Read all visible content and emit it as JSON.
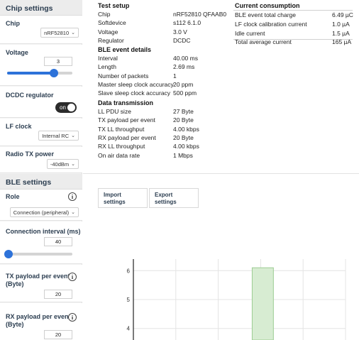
{
  "sidebar": {
    "chip_settings": {
      "title": "Chip settings",
      "chip_label": "Chip",
      "chip_value": "nRF52810",
      "voltage_label": "Voltage",
      "voltage_value": "3",
      "voltage_level": 0.72,
      "dcdc_label": "DCDC regulator",
      "dcdc_state": "on",
      "lf_clock_label": "LF clock",
      "lf_clock_value": "Internal RC",
      "radio_tx_label": "Radio TX power",
      "radio_tx_value": "-40dBm"
    },
    "ble_settings": {
      "title": "BLE settings",
      "role_label": "Role",
      "role_value": "Connection (peripheral)",
      "conn_interval_label": "Connection interval (ms)",
      "conn_interval_value": "40",
      "conn_interval_level": 0.02,
      "tx_payload_label_1": "TX payload per event",
      "tx_payload_label_2": "(Byte)",
      "tx_payload_value": "20",
      "rx_payload_label_1": "RX payload per event",
      "rx_payload_label_2": "(Byte)",
      "rx_payload_value": "20"
    }
  },
  "test_setup": {
    "title": "Test setup",
    "rows": [
      {
        "label": "Chip",
        "value": "nRF52810 QFAAB0"
      },
      {
        "label": "Softdevice",
        "value": "s112 6.1.0"
      },
      {
        "label": "Voltage",
        "value": "3.0 V"
      },
      {
        "label": "Regulator",
        "value": "DCDC"
      }
    ]
  },
  "ble_event_details": {
    "title": "BLE event details",
    "rows": [
      {
        "label": "Interval",
        "value": "40.00 ms"
      },
      {
        "label": "Length",
        "value": "2.69 ms"
      },
      {
        "label": "Number of packets",
        "value": "1"
      },
      {
        "label": "Master sleep clock accuracy",
        "value": "20 ppm"
      },
      {
        "label": "Slave sleep clock accuracy",
        "value": "500 ppm"
      }
    ]
  },
  "data_transmission": {
    "title": "Data transmission",
    "rows": [
      {
        "label": "LL PDU size",
        "value": "27 Byte"
      },
      {
        "label": "TX payload per event",
        "value": "20 Byte"
      },
      {
        "label": "TX LL throughput",
        "value": "4.00 kbps"
      },
      {
        "label": "RX payload per event",
        "value": "20 Byte"
      },
      {
        "label": "RX LL throughput",
        "value": "4.00 kbps"
      },
      {
        "label": "On air data rate",
        "value": "1 Mbps"
      }
    ]
  },
  "current_consumption": {
    "title": "Current consumption",
    "rows": [
      {
        "label": "BLE event total charge",
        "value": "6.49 µC"
      },
      {
        "label": "LF clock calibration current",
        "value": "1.0 µA"
      },
      {
        "label": "Idle current",
        "value": "1.5 µA"
      },
      {
        "label": "Total average current",
        "value": "165 µA"
      }
    ]
  },
  "buttons": {
    "import_1": "Import",
    "import_2": "settings",
    "export_1": "Export",
    "export_2": "settings"
  },
  "chart_data": {
    "type": "bar",
    "ylim": [
      3.6,
      6.4
    ],
    "yticks": [
      "6",
      "5",
      "4"
    ],
    "bar": {
      "x_start": 0.56,
      "x_end": 0.66,
      "value": 6.1
    },
    "colors": {
      "bar_fill": "#d7ecd2",
      "bar_stroke": "#9ccc93",
      "grid": "#e4e4e4",
      "axis": "#222222"
    }
  },
  "colors": {
    "accent": "#2d72d9",
    "heading": "#2b3d50"
  }
}
